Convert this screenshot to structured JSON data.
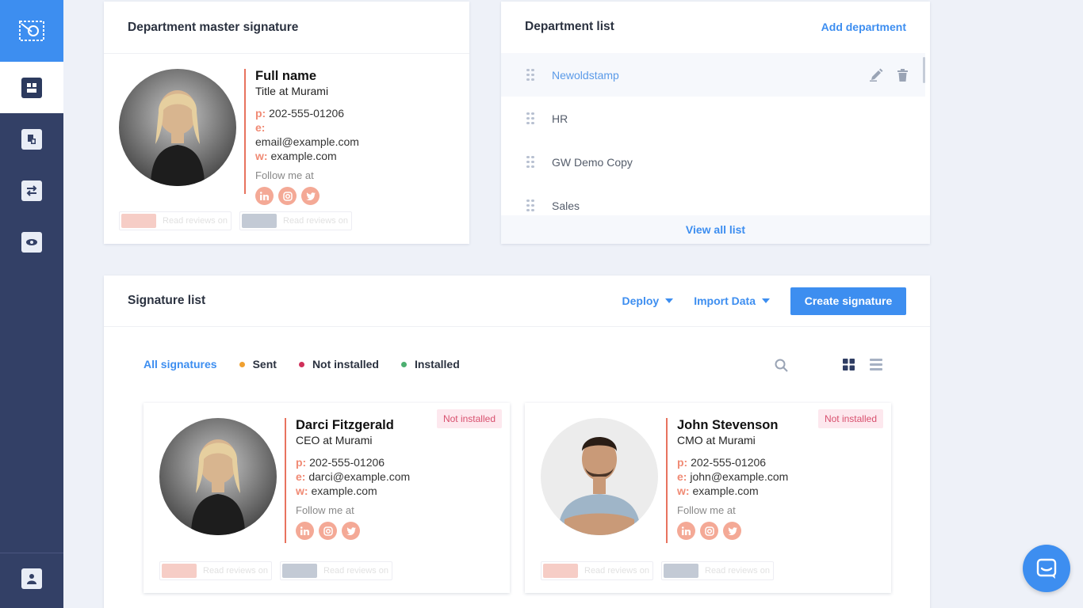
{
  "colors": {
    "accent": "#3d8ef0",
    "sidebar": "#334066",
    "sent": "#f0a030",
    "not_installed": "#d0305a",
    "installed": "#4caf70",
    "signature_line": "#e8735f"
  },
  "sidebar": {
    "logo_icon": "envelope-stamp-icon",
    "items": [
      {
        "icon": "dashboard-icon",
        "active": true
      },
      {
        "icon": "signatures-icon"
      },
      {
        "icon": "transfer-icon"
      },
      {
        "icon": "campaign-icon"
      }
    ],
    "bottom_item": {
      "icon": "user-icon"
    }
  },
  "master": {
    "title": "Department master signature",
    "signature": {
      "name": "Full name",
      "title": "Title at Murami",
      "phone_label": "p:",
      "phone": "202-555-01206",
      "email_label": "e:",
      "email": "email@example.com",
      "web_label": "w:",
      "web": "example.com",
      "follow": "Follow me at",
      "badge1": "Read reviews on",
      "badge2": "Read reviews on"
    }
  },
  "departments": {
    "title": "Department list",
    "add_label": "Add department",
    "items": [
      {
        "name": "Newoldstamp"
      },
      {
        "name": "HR"
      },
      {
        "name": "GW Demo Copy"
      },
      {
        "name": "Sales"
      }
    ],
    "view_all": "View all list"
  },
  "signature_list": {
    "title": "Signature list",
    "deploy": "Deploy",
    "import": "Import Data",
    "create": "Create signature",
    "filters": {
      "all": "All signatures",
      "sent": "Sent",
      "not_installed": "Not installed",
      "installed": "Installed"
    },
    "cards": [
      {
        "status": "Not installed",
        "name": "Darci Fitzgerald",
        "title": "CEO at Murami",
        "phone_label": "p:",
        "phone": "202-555-01206",
        "email_label": "e:",
        "email": "darci@example.com",
        "web_label": "w:",
        "web": "example.com",
        "follow": "Follow me at",
        "badge1": "Read reviews on",
        "badge2": "Read reviews on"
      },
      {
        "status": "Not installed",
        "name": "John Stevenson",
        "title": "CMO at Murami",
        "phone_label": "p:",
        "phone": "202-555-01206",
        "email_label": "e:",
        "email": "john@example.com",
        "web_label": "w:",
        "web": "example.com",
        "follow": "Follow me at",
        "badge1": "Read reviews on",
        "badge2": "Read reviews on"
      }
    ]
  }
}
